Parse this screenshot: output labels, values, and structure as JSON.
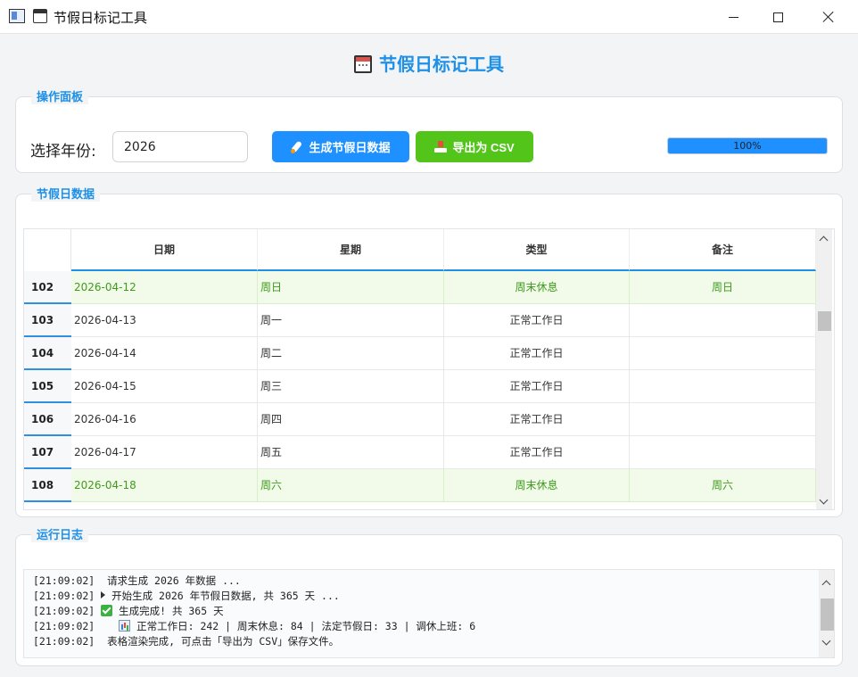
{
  "window": {
    "title": "节假日标记工具"
  },
  "header": {
    "title": "节假日标记工具",
    "icon": "calendar-icon"
  },
  "control_panel": {
    "title": "操作面板",
    "year_label": "选择年份:",
    "year_value": "2026",
    "generate_label": "生成节假日数据",
    "export_label": "导出为 CSV",
    "progress_text": "100%",
    "progress_fraction": 1.0,
    "accent": "#1e90ff",
    "export_color": "#52c41a"
  },
  "data_panel": {
    "title": "节假日数据",
    "columns": [
      "日期",
      "星期",
      "类型",
      "备注"
    ],
    "rows": [
      {
        "num": "102",
        "date": "2026-04-12",
        "weekday": "周日",
        "type": "周末休息",
        "note": "周日",
        "kind": "weekend"
      },
      {
        "num": "103",
        "date": "2026-04-13",
        "weekday": "周一",
        "type": "正常工作日",
        "note": "",
        "kind": "work"
      },
      {
        "num": "104",
        "date": "2026-04-14",
        "weekday": "周二",
        "type": "正常工作日",
        "note": "",
        "kind": "work"
      },
      {
        "num": "105",
        "date": "2026-04-15",
        "weekday": "周三",
        "type": "正常工作日",
        "note": "",
        "kind": "work"
      },
      {
        "num": "106",
        "date": "2026-04-16",
        "weekday": "周四",
        "type": "正常工作日",
        "note": "",
        "kind": "work"
      },
      {
        "num": "107",
        "date": "2026-04-17",
        "weekday": "周五",
        "type": "正常工作日",
        "note": "",
        "kind": "work"
      },
      {
        "num": "108",
        "date": "2026-04-18",
        "weekday": "周六",
        "type": "周末休息",
        "note": "周六",
        "kind": "weekend"
      }
    ],
    "weekend_bg": "#f2fbe9",
    "weekend_text": "#3f9b1c"
  },
  "log_panel": {
    "title": "运行日志",
    "lines": [
      {
        "time": "[21:09:02]",
        "icon": "",
        "text": " 请求生成 2026 年数据 ..."
      },
      {
        "time": "[21:09:02]",
        "icon": "play-triangle-icon",
        "text": " 开始生成 2026 年节假日数据, 共 365 天 ..."
      },
      {
        "time": "[21:09:02]",
        "icon": "check-icon",
        "text": " 生成完成! 共 365 天"
      },
      {
        "time": "[21:09:02]",
        "icon": "chart-icon",
        "text": " 正常工作日: 242 | 周末休息: 84 | 法定节假日: 33 | 调休上班: 6"
      },
      {
        "time": "[21:09:02]",
        "icon": "",
        "text": " 表格渲染完成, 可点击「导出为 CSV」保存文件。"
      }
    ]
  }
}
